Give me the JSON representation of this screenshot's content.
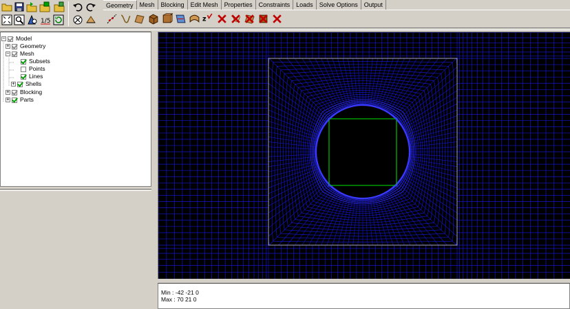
{
  "tabs": [
    {
      "label": "Geometry",
      "active": true
    },
    {
      "label": "Mesh",
      "active": false
    },
    {
      "label": "Blocking",
      "active": false
    },
    {
      "label": "Edit Mesh",
      "active": false
    },
    {
      "label": "Properties",
      "active": false
    },
    {
      "label": "Constraints",
      "active": false
    },
    {
      "label": "Loads",
      "active": false
    },
    {
      "label": "Solve Options",
      "active": false
    },
    {
      "label": "Output",
      "active": false
    }
  ],
  "left_toolbar_icons": [
    "open-folder-icon",
    "save-icon",
    "open-geometry-icon",
    "save-geometry-icon",
    "open-blocking-icon",
    "undo-icon",
    "redo-icon",
    "fit-window-icon",
    "zoom-icon",
    "measure-icon",
    "quality-icon",
    "refresh-icon",
    "tools-icon"
  ],
  "geometry_icons": [
    "create-point-icon",
    "create-curve-icon",
    "create-surface-icon",
    "create-body-icon",
    "faceted-icon",
    "repair-geometry-icon",
    "transform-icon",
    "restore-dormant-icon",
    "delete-point-icon",
    "delete-curve-icon",
    "delete-surface-icon",
    "delete-body-icon",
    "delete-any-icon"
  ],
  "tree": {
    "items": [
      {
        "label": "Model",
        "level": 0,
        "expander": "-",
        "checked": true,
        "gray": true
      },
      {
        "label": "Geometry",
        "level": 1,
        "expander": "+",
        "checked": true,
        "gray": true
      },
      {
        "label": "Mesh",
        "level": 1,
        "expander": "-",
        "checked": true,
        "gray": true
      },
      {
        "label": "Subsets",
        "level": 2,
        "expander": "",
        "checked": true,
        "gray": false
      },
      {
        "label": "Points",
        "level": 2,
        "expander": "",
        "checked": false,
        "gray": false
      },
      {
        "label": "Lines",
        "level": 2,
        "expander": "",
        "checked": true,
        "gray": false
      },
      {
        "label": "Shells",
        "level": 2,
        "expander": "+",
        "checked": true,
        "gray": false
      },
      {
        "label": "Blocking",
        "level": 1,
        "expander": "+",
        "checked": true,
        "gray": true
      },
      {
        "label": "Parts",
        "level": 1,
        "expander": "+",
        "checked": true,
        "gray": false
      }
    ]
  },
  "messages": {
    "min": "Min : -42 -21 0",
    "max": "Max : 70 21 0"
  },
  "colors": {
    "mesh_line": "#1515c8",
    "mesh_dense": "#2c2cff",
    "circle_edge": "#3a3aff",
    "block_square": "#00c000",
    "outer_box": "#c8c8c8",
    "background": "#000000"
  }
}
